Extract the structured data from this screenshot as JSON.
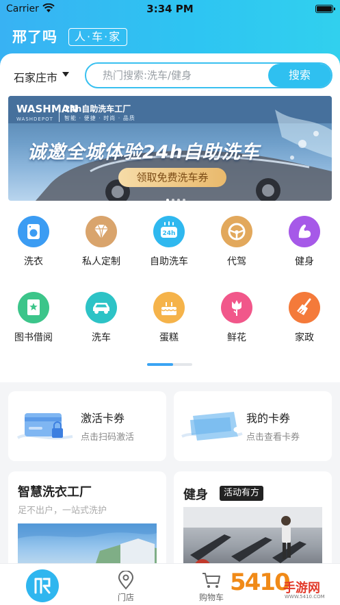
{
  "status_bar": {
    "carrier": "Carrier",
    "time": "3:34 PM"
  },
  "brand": {
    "logo": "WASHMAN",
    "tagline": "人·车·家"
  },
  "location": {
    "city": "石家庄市"
  },
  "search": {
    "placeholder": "热门搜索:洗车/健身",
    "button": "搜索"
  },
  "banner": {
    "logo_text": "WASHMAN",
    "logo_sub": "WASHDEPOT",
    "title": "24h自助洗车工厂",
    "subtitle": "智能 · 便捷 · 时尚 · 品质",
    "headline": "诚邀全城体验24h自助洗车",
    "cta": "领取免费洗车券",
    "slide_count": 4,
    "active_slide": 1
  },
  "categories": [
    {
      "label": "洗衣",
      "icon": "washing-machine-icon",
      "color": "#3b9cf3"
    },
    {
      "label": "私人定制",
      "icon": "diamond-icon",
      "color": "#d9a46c"
    },
    {
      "label": "自助洗车",
      "icon": "car-wash-24h-icon",
      "color": "#2fb8ef"
    },
    {
      "label": "代驾",
      "icon": "steering-wheel-icon",
      "color": "#e2a85c"
    },
    {
      "label": "健身",
      "icon": "muscle-arm-icon",
      "color": "#a659e8"
    },
    {
      "label": "图书借阅",
      "icon": "book-star-icon",
      "color": "#3cc58a"
    },
    {
      "label": "洗车",
      "icon": "car-icon",
      "color": "#2dc3c6"
    },
    {
      "label": "蛋糕",
      "icon": "cake-icon",
      "color": "#f5b34a"
    },
    {
      "label": "鲜花",
      "icon": "flower-icon",
      "color": "#f1578a"
    },
    {
      "label": "家政",
      "icon": "broom-icon",
      "color": "#f47a3a"
    }
  ],
  "category_pager": {
    "position": "1 of 2"
  },
  "cards": {
    "activate": {
      "title": "激活卡券",
      "subtitle": "点击扫码激活",
      "icon": "card-lock-icon"
    },
    "my_coupons": {
      "title": "我的卡券",
      "subtitle": "点击查看卡券",
      "icon": "ticket-icon"
    },
    "laundry_factory": {
      "title": "智慧洗衣工厂",
      "subtitle": "足不出户，一站式洗护"
    },
    "fitness": {
      "title": "健身",
      "badge": "活动有方"
    }
  },
  "tabbar": {
    "items": [
      {
        "label": "",
        "icon": "home-logo-icon",
        "active": true
      },
      {
        "label": "门店",
        "icon": "location-pin-icon"
      },
      {
        "label": "购物车",
        "icon": "cart-icon"
      }
    ]
  },
  "watermark": {
    "text": "5410",
    "cn": "手游网",
    "sub": "WWW.5410.COM"
  },
  "colors": {
    "accent": "#2fc0f0",
    "header_start": "#38b2f3",
    "pager_active": "#3aa4f3"
  }
}
